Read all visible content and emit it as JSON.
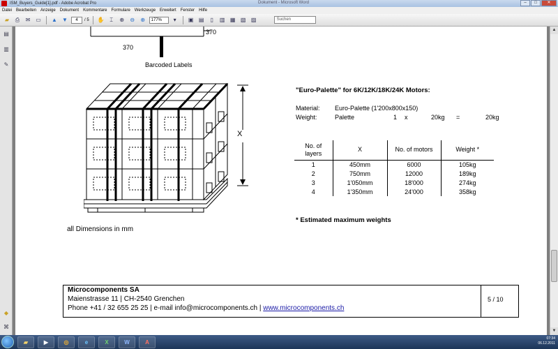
{
  "window": {
    "title": "ISM_Buyers_Guide[1].pdf - Adobe Acrobat Pro",
    "center_title": "Dokument - Microsoft Word"
  },
  "menu": [
    "Datei",
    "Bearbeiten",
    "Anzeige",
    "Dokument",
    "Kommentare",
    "Formulare",
    "Werkzeuge",
    "Erweitert",
    "Fenster",
    "Hilfe"
  ],
  "toolbar": {
    "page_current": "4",
    "page_total": "/ 5",
    "zoom": "177%",
    "search_placeholder": "Suchen"
  },
  "document": {
    "dim_370_top": "370",
    "dim_370_bottom": "370",
    "barcoded_label": "Barcoded Labels",
    "height_label": "X",
    "all_dimensions": "all Dimensions in mm",
    "heading": "\"Euro-Palette\" for 6K/12K/18K/24K Motors:",
    "material_label": "Material:",
    "material_value": "Euro-Palette (1'200x800x150)",
    "weight_label": "Weight:",
    "weight_value": "Palette",
    "weight_qty": "1",
    "weight_x": "x",
    "weight_per": "20kg",
    "weight_eq": "=",
    "weight_total": "20kg",
    "note": "*   Estimated maximum weights",
    "table": {
      "headers": [
        "No. of layers",
        "X",
        "No. of motors",
        "Weight *"
      ],
      "rows": [
        [
          "1",
          "450mm",
          "6000",
          "105kg"
        ],
        [
          "2",
          "750mm",
          "12000",
          "189kg"
        ],
        [
          "3",
          "1'050mm",
          "18'000",
          "274kg"
        ],
        [
          "4",
          "1'350mm",
          "24'000",
          "358kg"
        ]
      ]
    }
  },
  "footer": {
    "company": "Microcomponents SA",
    "address": "Maienstrasse 11   | CH-2540 Grenchen",
    "contact": "Phone  +41 / 32 655 25 25 | e-mail  info@microcomponents.ch    | ",
    "website": "www.microcomponents.ch",
    "page": "5 / 10"
  },
  "taskbar": {
    "time": "07:34",
    "date": "06.12.2011"
  }
}
